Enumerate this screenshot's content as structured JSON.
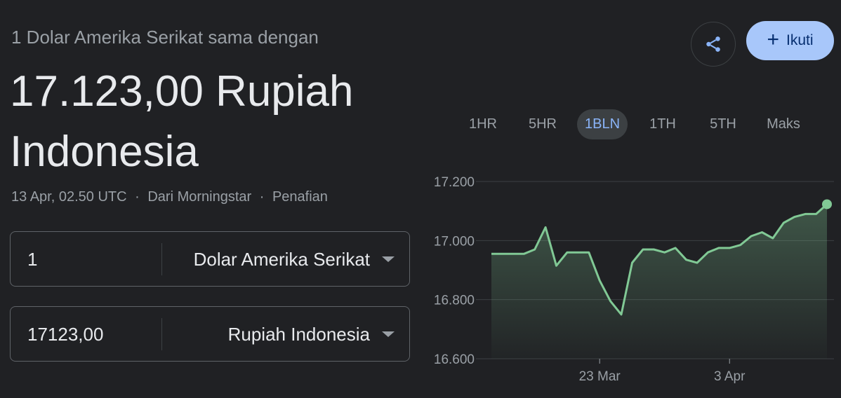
{
  "header": {
    "subtitle": "1 Dolar Amerika Serikat sama dengan",
    "result": "17.123,00 Rupiah Indonesia",
    "timestamp": "13 Apr, 02.50 UTC",
    "separator": "·",
    "source": "Dari Morningstar",
    "disclaimer": "Penafian"
  },
  "converter": {
    "from": {
      "value": "1",
      "currency": "Dolar Amerika Serikat"
    },
    "to": {
      "value": "17123,00",
      "currency": "Rupiah Indonesia"
    }
  },
  "actions": {
    "share_icon": "share-icon",
    "follow_label": "Ikuti",
    "follow_icon": "+"
  },
  "tabs": [
    {
      "label": "1HR"
    },
    {
      "label": "5HR"
    },
    {
      "label": "1BLN",
      "active": true
    },
    {
      "label": "1TH"
    },
    {
      "label": "5TH"
    },
    {
      "label": "Maks"
    }
  ],
  "colors": {
    "background": "#202124",
    "line": "#81c995",
    "accent": "#8ab4f8",
    "follow_button": "#a8c7fa"
  },
  "chart_data": {
    "type": "area",
    "title": "",
    "xlabel": "",
    "ylabel": "",
    "ylim": [
      16600,
      17200
    ],
    "y_ticks": [
      "17.200",
      "17.000",
      "16.800",
      "16.600"
    ],
    "x_ticks": [
      "23 Mar",
      "3 Apr"
    ],
    "grid": true,
    "series": [
      {
        "values": [
          16955,
          16955,
          16955,
          16955,
          16970,
          17045,
          16915,
          16960,
          16960,
          16960,
          16865,
          16795,
          16750,
          16925,
          16970,
          16970,
          16960,
          16975,
          16935,
          16925,
          16960,
          16975,
          16975,
          16985,
          17015,
          17028,
          17008,
          17060,
          17080,
          17090,
          17090,
          17123
        ]
      }
    ]
  }
}
